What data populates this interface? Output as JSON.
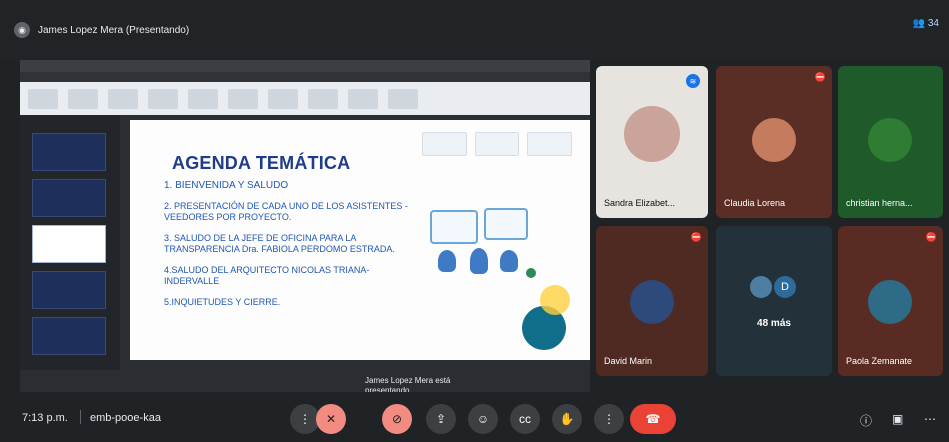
{
  "header": {
    "presenter_title": "James Lopez Mera (Presentando)",
    "right_label": "34"
  },
  "slide": {
    "title": "AGENDA TEMÁTICA",
    "items": [
      "1. BIENVENIDA Y SALUDO",
      "2. PRESENTACIÓN DE CADA UNO DE LOS ASISTENTES - VEEDORES POR PROYECTO.",
      "3. SALUDO DE LA JEFE DE OFICINA PARA LA TRANSPARENCIA Dra. FABIOLA PERDOMO ESTRADA.",
      "4.SALUDO DEL ARQUITECTO NICOLAS TRIANA-INDERVALLE",
      "5.INQUIETUDES Y CIERRE."
    ]
  },
  "presenting_badge": "James Lopez Mera está presentando",
  "participants": [
    {
      "name": "Sandra Elizabet..."
    },
    {
      "name": "Claudia Lorena"
    },
    {
      "name": "christian herna..."
    },
    {
      "name": "David Marin"
    },
    {
      "name": "48 más",
      "avatar_letter": "D"
    },
    {
      "name": "Paola Zemanate"
    }
  ],
  "bottom": {
    "time": "7:13 p.m.",
    "code": "emb-pooe-kaa"
  },
  "colors": {
    "bg": "#1f2326",
    "accent_blue": "#1a73e8",
    "danger_red": "#ea4335",
    "mic_off": "#f28b82"
  }
}
